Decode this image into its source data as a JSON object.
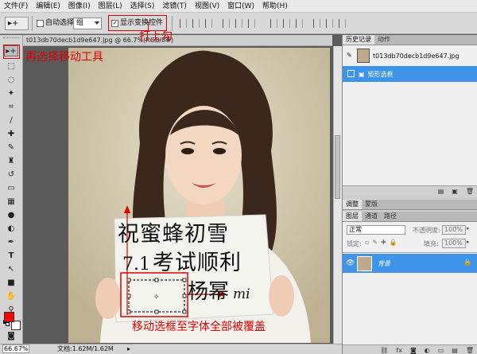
{
  "menu": [
    "文件(F)",
    "编辑(E)",
    "图像(I)",
    "图层(L)",
    "选择(S)",
    "滤镜(T)",
    "视图(V)",
    "窗口(W)",
    "帮助(H)"
  ],
  "options": {
    "tool_preset": "▸+",
    "auto_select_label": "自动选择:",
    "auto_select_value": "组",
    "show_transform_label": "显示变换控件"
  },
  "document": {
    "tab_title": "t013db70decb1d9e647.jpg @ 66.7%(RGB/8#)",
    "zoom": "66.67%",
    "doc_size": "文档:1.62M/1.62M"
  },
  "panels": {
    "history_tab": "历史记录",
    "actions_tab": "动作",
    "history_snapshot": "t013db70decb1d9e647.jpg",
    "history_step": "矩形选框",
    "adjust_tab": "调整",
    "mask_tab": "蒙版",
    "layers_tab": "图层",
    "channels_tab": "通道",
    "paths_tab": "路径",
    "blend_mode": "正常",
    "opacity_label": "不透明度:",
    "opacity_value": "100%",
    "lock_label": "锁定:",
    "fill_label": "填充:",
    "fill_value": "100%",
    "layer_name": "背景"
  },
  "annotations": {
    "tick_note": "打上勾",
    "select_tool_note": "再选择移动工具",
    "move_note": "移动选框至字体全部被覆盖"
  },
  "photo_text": {
    "line1": "祝蜜蜂初雪",
    "line2_num": "7.1",
    "line2": "考试顺利",
    "line3": "杨幂",
    "line3_mi": "mi"
  },
  "colors": {
    "accent": "#3d94e8",
    "annotation": "#e00000",
    "foreground": "#ff0000",
    "background": "#ffffff"
  }
}
